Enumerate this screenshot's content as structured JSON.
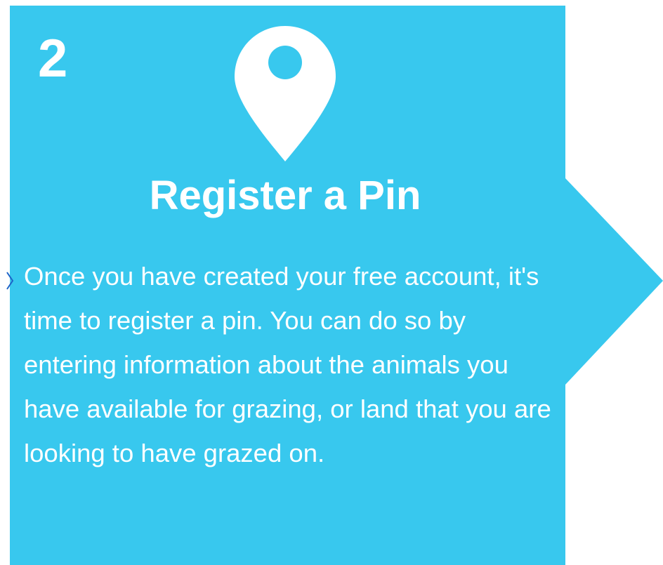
{
  "card": {
    "step_number": "2",
    "icon": "map-pin-icon",
    "title": "Register a Pin",
    "body": "Once you have created your free account, it's time to register a pin. You can do so by entering information about the animals you have available for grazing, or land that you are looking to have grazed on."
  },
  "colors": {
    "card_background": "#38c8ee",
    "text": "#ffffff",
    "connector": "#1e64c8"
  }
}
